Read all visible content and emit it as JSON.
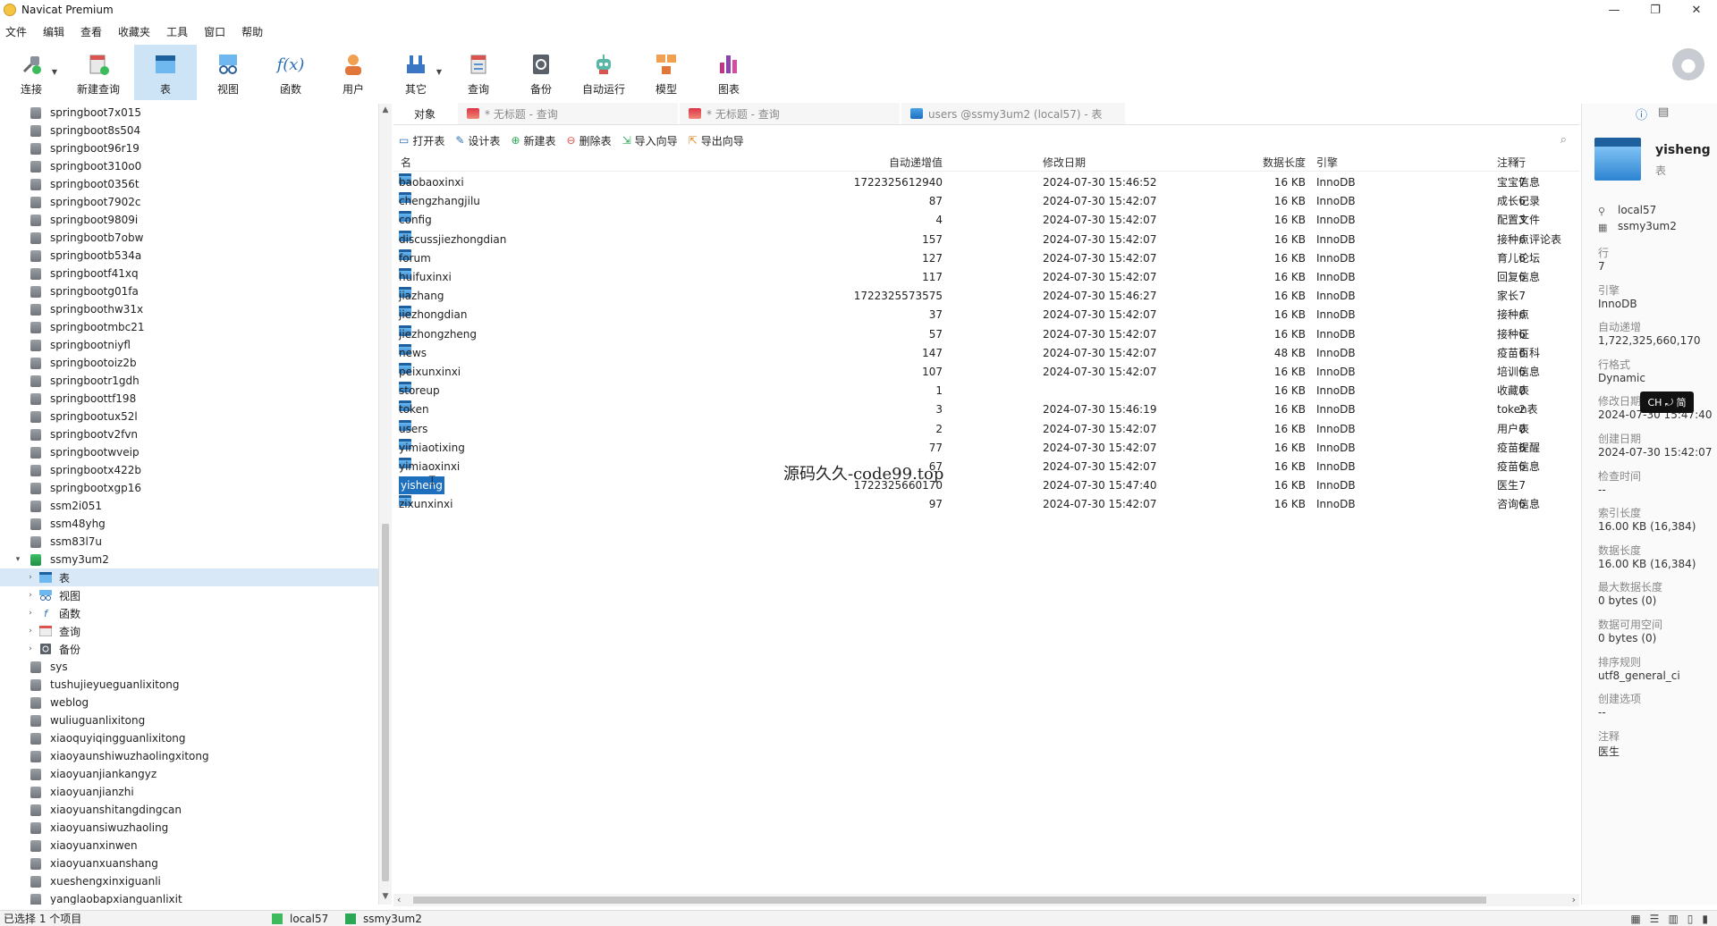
{
  "window": {
    "title": "Navicat Premium",
    "controls": [
      "—",
      "❐",
      "✕"
    ]
  },
  "menu": [
    "文件",
    "编辑",
    "查看",
    "收藏夹",
    "工具",
    "窗口",
    "帮助"
  ],
  "toolbar": {
    "buttons": [
      {
        "label": "连接",
        "icon": "plug-icon"
      },
      {
        "label": "新建查询",
        "icon": "new-query-icon"
      },
      {
        "label": "表",
        "icon": "table-icon",
        "active": true
      },
      {
        "label": "视图",
        "icon": "view-icon"
      },
      {
        "label": "函数",
        "icon": "function-icon",
        "glyph": "f(x)"
      },
      {
        "label": "用户",
        "icon": "user-icon"
      },
      {
        "label": "其它",
        "icon": "other-icon"
      },
      {
        "label": "查询",
        "icon": "query-icon"
      },
      {
        "label": "备份",
        "icon": "backup-icon"
      },
      {
        "label": "自动运行",
        "icon": "robot-icon"
      },
      {
        "label": "模型",
        "icon": "model-icon"
      },
      {
        "label": "图表",
        "icon": "chart-icon"
      }
    ]
  },
  "nav": {
    "databases_before": [
      "springboot7x015",
      "springboot8s504",
      "springboot96r19",
      "springboot310o0",
      "springboot0356t",
      "springboot7902c",
      "springboot9809i",
      "springbootb7obw",
      "springbootb534a",
      "springbootf41xq",
      "springbootg01fa",
      "springboothw31x",
      "springbootmbc21",
      "springbootniyfl",
      "springbootoiz2b",
      "springbootr1gdh",
      "springboottf198",
      "springbootux52l",
      "springbootv2fvn",
      "springbootwveip",
      "springbootx422b",
      "springbootxgp16",
      "ssm2i051",
      "ssm48yhg",
      "ssm83l7u"
    ],
    "open_database": "ssmy3um2",
    "children": [
      {
        "label": "表",
        "icon": "table-icon"
      },
      {
        "label": "视图",
        "icon": "view-icon"
      },
      {
        "label": "函数",
        "icon": "function-icon"
      },
      {
        "label": "查询",
        "icon": "query-icon"
      },
      {
        "label": "备份",
        "icon": "backup-icon"
      }
    ],
    "databases_after": [
      "sys",
      "tushujieyueguanlixitong",
      "weblog",
      "wuliuguanlixitong",
      "xiaoquyiqingguanlixitong",
      "xiaoyaunshiwuzhaolingxitong",
      "xiaoyuanjiankangyz",
      "xiaoyuanjianzhi",
      "xiaoyuanshitangdingcan",
      "xiaoyuansiwuzhaoling",
      "xiaoyuanxinwen",
      "xiaoyuanxuanshang",
      "xueshengxinxiguanli",
      "yanglaobapxianguanlixit"
    ]
  },
  "tabs": [
    {
      "label": "对象",
      "kind": "objects"
    },
    {
      "label": "* 无标题 - 查询",
      "kind": "query"
    },
    {
      "label": "* 无标题 - 查询",
      "kind": "query"
    },
    {
      "label": "users @ssmy3um2 (local57) - 表",
      "kind": "table"
    }
  ],
  "object_toolbar": [
    {
      "label": "打开表",
      "icon": "open-table-icon"
    },
    {
      "label": "设计表",
      "icon": "design-table-icon"
    },
    {
      "label": "新建表",
      "icon": "new-table-icon"
    },
    {
      "label": "删除表",
      "icon": "delete-table-icon"
    },
    {
      "label": "导入向导",
      "icon": "import-icon"
    },
    {
      "label": "导出向导",
      "icon": "export-icon"
    }
  ],
  "columns": {
    "name": "名",
    "auto_increment": "自动递增值",
    "modified": "修改日期",
    "data_length": "数据长度",
    "engine": "引擎",
    "rows": "行",
    "comment": "注释"
  },
  "tables": [
    {
      "name": "baobaoxinxi",
      "auto": "1722325612940",
      "modified": "2024-07-30 15:46:52",
      "size": "16 KB",
      "engine": "InnoDB",
      "rows": "7",
      "comment": "宝宝信息"
    },
    {
      "name": "chengzhangjilu",
      "auto": "87",
      "modified": "2024-07-30 15:42:07",
      "size": "16 KB",
      "engine": "InnoDB",
      "rows": "6",
      "comment": "成长记录"
    },
    {
      "name": "config",
      "auto": "4",
      "modified": "2024-07-30 15:42:07",
      "size": "16 KB",
      "engine": "InnoDB",
      "rows": "3",
      "comment": "配置文件"
    },
    {
      "name": "discussjiezhongdian",
      "auto": "157",
      "modified": "2024-07-30 15:42:07",
      "size": "16 KB",
      "engine": "InnoDB",
      "rows": "6",
      "comment": "接种点评论表"
    },
    {
      "name": "forum",
      "auto": "127",
      "modified": "2024-07-30 15:42:07",
      "size": "16 KB",
      "engine": "InnoDB",
      "rows": "6",
      "comment": "育儿论坛"
    },
    {
      "name": "huifuxinxi",
      "auto": "117",
      "modified": "2024-07-30 15:42:07",
      "size": "16 KB",
      "engine": "InnoDB",
      "rows": "6",
      "comment": "回复信息"
    },
    {
      "name": "jiazhang",
      "auto": "1722325573575",
      "modified": "2024-07-30 15:46:27",
      "size": "16 KB",
      "engine": "InnoDB",
      "rows": "7",
      "comment": "家长"
    },
    {
      "name": "jiezhongdian",
      "auto": "37",
      "modified": "2024-07-30 15:42:07",
      "size": "16 KB",
      "engine": "InnoDB",
      "rows": "6",
      "comment": "接种点"
    },
    {
      "name": "jiezhongzheng",
      "auto": "57",
      "modified": "2024-07-30 15:42:07",
      "size": "16 KB",
      "engine": "InnoDB",
      "rows": "6",
      "comment": "接种证"
    },
    {
      "name": "news",
      "auto": "147",
      "modified": "2024-07-30 15:42:07",
      "size": "48 KB",
      "engine": "InnoDB",
      "rows": "6",
      "comment": "疫苗百科"
    },
    {
      "name": "peixunxinxi",
      "auto": "107",
      "modified": "2024-07-30 15:42:07",
      "size": "16 KB",
      "engine": "InnoDB",
      "rows": "6",
      "comment": "培训信息"
    },
    {
      "name": "storeup",
      "auto": "1",
      "modified": "",
      "size": "16 KB",
      "engine": "InnoDB",
      "rows": "0",
      "comment": "收藏表"
    },
    {
      "name": "token",
      "auto": "3",
      "modified": "2024-07-30 15:46:19",
      "size": "16 KB",
      "engine": "InnoDB",
      "rows": "2",
      "comment": "token表"
    },
    {
      "name": "users",
      "auto": "2",
      "modified": "2024-07-30 15:42:07",
      "size": "16 KB",
      "engine": "InnoDB",
      "rows": "0",
      "comment": "用户表"
    },
    {
      "name": "yimiaotixing",
      "auto": "77",
      "modified": "2024-07-30 15:42:07",
      "size": "16 KB",
      "engine": "InnoDB",
      "rows": "6",
      "comment": "疫苗提醒"
    },
    {
      "name": "yimiaoxinxi",
      "auto": "67",
      "modified": "2024-07-30 15:42:07",
      "size": "16 KB",
      "engine": "InnoDB",
      "rows": "6",
      "comment": "疫苗信息"
    },
    {
      "name": "yisheng",
      "auto": "1722325660170",
      "modified": "2024-07-30 15:47:40",
      "size": "16 KB",
      "engine": "InnoDB",
      "rows": "7",
      "comment": "医生",
      "selected": true
    },
    {
      "name": "zixunxinxi",
      "auto": "97",
      "modified": "2024-07-30 15:42:07",
      "size": "16 KB",
      "engine": "InnoDB",
      "rows": "6",
      "comment": "咨询信息"
    }
  ],
  "overlay_text": "源码久久-code99.top",
  "info_panel": {
    "name": "yisheng",
    "type": "表",
    "connection": "local57",
    "database": "ssmy3um2",
    "props": [
      {
        "label": "行",
        "value": "7"
      },
      {
        "label": "引擎",
        "value": "InnoDB"
      },
      {
        "label": "自动递增",
        "value": "1,722,325,660,170"
      },
      {
        "label": "行格式",
        "value": "Dynamic"
      },
      {
        "label": "修改日期",
        "value": "2024-07-30 15:47:40"
      },
      {
        "label": "创建日期",
        "value": "2024-07-30 15:42:07"
      },
      {
        "label": "检查时间",
        "value": "--"
      },
      {
        "label": "索引长度",
        "value": "16.00 KB (16,384)"
      },
      {
        "label": "数据长度",
        "value": "16.00 KB (16,384)"
      },
      {
        "label": "最大数据长度",
        "value": "0 bytes (0)"
      },
      {
        "label": "数据可用空间",
        "value": "0 bytes (0)"
      },
      {
        "label": "排序规则",
        "value": "utf8_general_ci"
      },
      {
        "label": "创建选项",
        "value": "--"
      },
      {
        "label": "注释",
        "value": "医生"
      }
    ]
  },
  "ime": "CH ⤾ 简",
  "status": {
    "selection": "已选择 1 个项目",
    "connection": "local57",
    "database": "ssmy3um2"
  },
  "colors": {
    "accent": "#1f6fbf",
    "active_tool": "#cde4f7",
    "db_open": "#2aa855"
  }
}
